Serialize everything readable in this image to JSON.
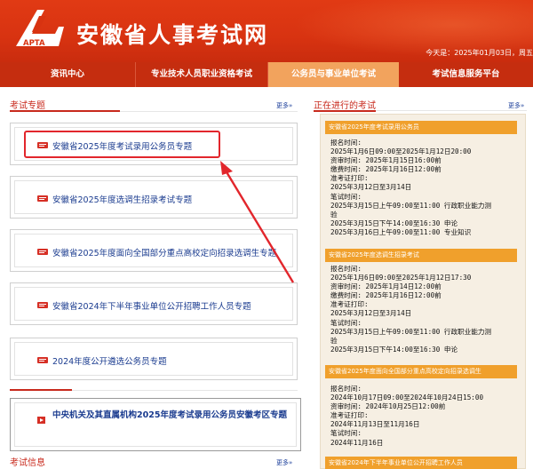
{
  "header": {
    "logo_text": "APTA",
    "site_title": "安徽省人事考试网",
    "date_text": "今天是：2025年01月03日，周五"
  },
  "nav": [
    {
      "label": "资讯中心"
    },
    {
      "label": "专业技术人员职业资格考试"
    },
    {
      "label": "公务员与事业单位考试"
    },
    {
      "label": "考试信息服务平台"
    }
  ],
  "left": {
    "section_title": "考试专题",
    "more": "更多",
    "topics": [
      {
        "label": "安徽省2025年度考试录用公务员专题"
      },
      {
        "label": "安徽省2025年度选调生招录考试专题"
      },
      {
        "label": "安徽省2025年度面向全国部分重点高校定向招录选调生专题"
      },
      {
        "label": "安徽省2024年下半年事业单位公开招聘工作人员专题"
      },
      {
        "label": "2024年度公开遴选公务员专题"
      }
    ],
    "special_topic": "中央机关及其直属机构2025年度考试录用公务员安徽考区专题",
    "info_title": "考试信息",
    "info_more": "更多"
  },
  "right": {
    "title": "正在进行的考试",
    "more": "更多",
    "exams": [
      {
        "header": "安徽省2025年度考试录用公务员",
        "lines": [
          "报名时间:",
          "2025年1月6日09:00至2025年1月12日20:00",
          "资审时间: 2025年1月15日16:00前",
          "缴费时间: 2025年1月16日12:00前",
          "准考证打印:",
          "2025年3月12日至3月14日",
          "笔试时间:",
          "2025年3月15日上午09:00至11:00 行政职业能力测",
          "验",
          "2025年3月15日下午14:00至16:30 申论",
          "2025年3月16日上午09:00至11:00 专业知识"
        ]
      },
      {
        "header": "安徽省2025年度选调生招录考试",
        "lines": [
          "报名时间:",
          "2025年1月6日09:00至2025年1月12日17:30",
          "资审时间: 2025年1月14日12:00前",
          "缴费时间: 2025年1月16日12:00前",
          "准考证打印:",
          "2025年3月12日至3月14日",
          "笔试时间:",
          "2025年3月15日上午09:00至11:00 行政职业能力测",
          "验",
          "2025年3月15日下午14:00至16:30 申论"
        ]
      },
      {
        "header": "安徽省2025年度面向全国部分重点高校定向招录选调生",
        "lines": [
          "报名时间:",
          "2024年10月17日09:00至2024年10月24日15:00",
          "资审时间: 2024年10月25日12:00前",
          "准考证打印:",
          "2024年11月13日至11月16日",
          "笔试时间:",
          "2024年11月16日"
        ]
      },
      {
        "header": "安徽省2024年下半年事业单位公开招聘工作人员",
        "lines": []
      }
    ]
  },
  "colors": {
    "header_red": "#d83311",
    "nav_red": "#c52d0f",
    "nav_active": "#f2a35d",
    "exam_header_orange": "#f0a02c",
    "link_blue": "#1a3b8f",
    "highlight_red": "#e2262c"
  }
}
